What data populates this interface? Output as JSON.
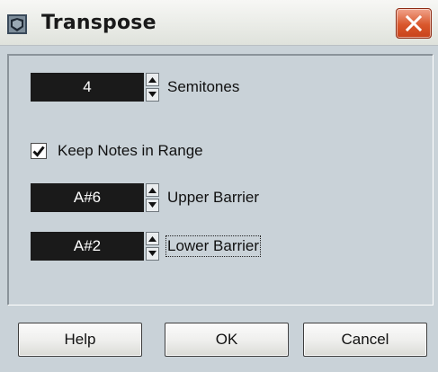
{
  "window": {
    "title": "Transpose",
    "icon": "app-icon",
    "close_icon": "close-icon"
  },
  "semitones": {
    "value": "4",
    "label": "Semitones"
  },
  "keep_range": {
    "label": "Keep Notes in Range",
    "checked": true
  },
  "upper_barrier": {
    "value": "A#6",
    "label": "Upper Barrier"
  },
  "lower_barrier": {
    "value": "A#2",
    "label": "Lower Barrier"
  },
  "buttons": {
    "help": "Help",
    "ok": "OK",
    "cancel": "Cancel"
  },
  "colors": {
    "dialog_bg": "#c9d2d8",
    "field_bg": "#1a1a1a",
    "close_red": "#d9572c"
  }
}
